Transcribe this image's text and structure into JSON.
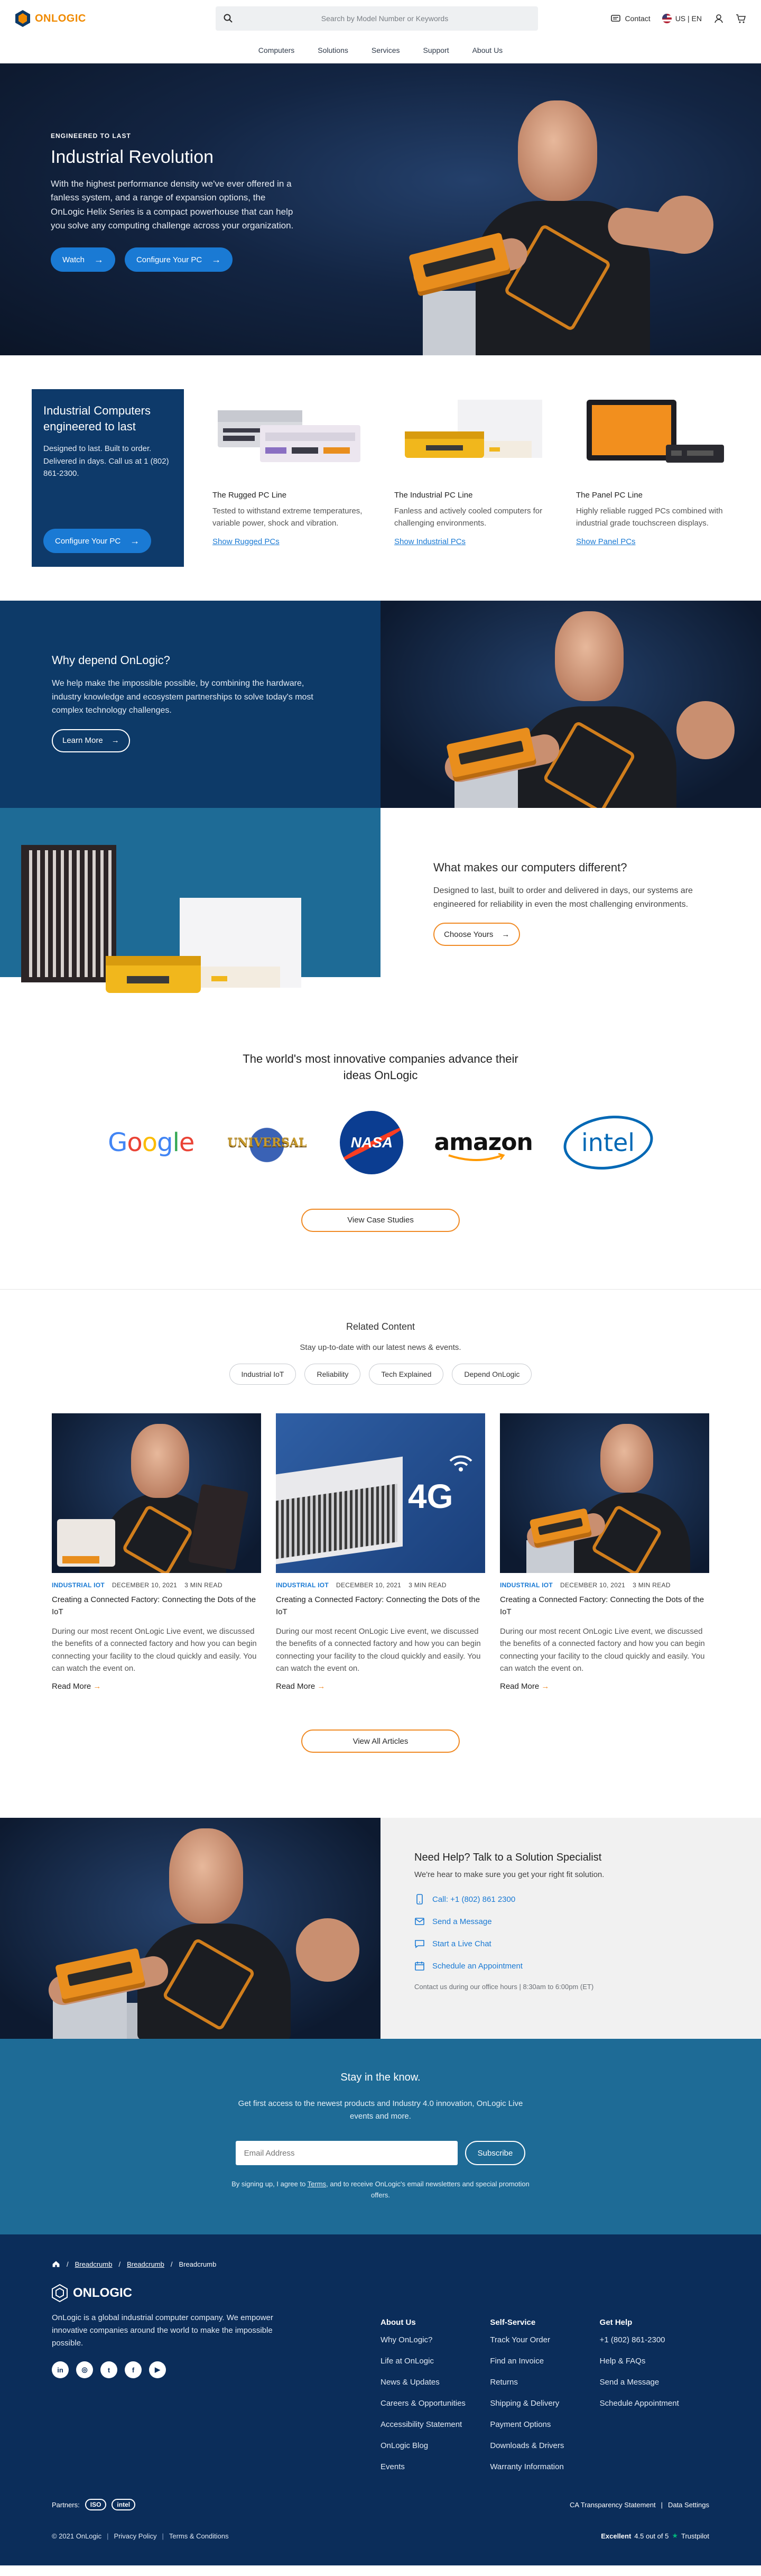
{
  "header": {
    "brand": "ONLOGIC",
    "search_placeholder": "Search by Model Number or Keywords",
    "contact": "Contact",
    "locale": "US | EN",
    "nav": [
      "Computers",
      "Solutions",
      "Services",
      "Support",
      "About Us"
    ]
  },
  "hero": {
    "eyebrow": "ENGINEERED TO LAST",
    "title": "Industrial Revolution",
    "body": "With the highest performance density we've ever offered in a fanless system, and a range of expansion options, the OnLogic Helix Series is a compact powerhouse that can help you solve any computing challenge across your organization.",
    "watch": "Watch",
    "configure": "Configure Your PC"
  },
  "lines": {
    "card_title": "Industrial Computers engineered to last",
    "card_body": "Designed to last. Built to order. Delivered in days. Call us at 1 (802) 861-2300.",
    "card_button": "Configure Your PC",
    "products": [
      {
        "name": "The Rugged PC Line",
        "desc": "Tested to withstand extreme temperatures, variable power, shock and vibration.",
        "link": "Show Rugged PCs"
      },
      {
        "name": "The Industrial PC Line",
        "desc": "Fanless and actively cooled computers for challenging environments.",
        "link": "Show Industrial PCs"
      },
      {
        "name": "The Panel PC Line",
        "desc": "Highly reliable rugged PCs combined with industrial grade touchscreen displays.",
        "link": "Show Panel PCs"
      }
    ]
  },
  "why": {
    "title": "Why depend OnLogic?",
    "body": "We help make the impossible possible, by combining the hardware, industry knowledge and ecosystem partnerships to solve today's most complex technology challenges.",
    "button": "Learn More"
  },
  "diff": {
    "title": "What makes our computers different?",
    "body": "Designed to last, built to order and delivered in days, our systems are engineered for reliability in even the most challenging environments.",
    "button": "Choose Yours"
  },
  "logos": {
    "title": "The world's most innovative companies advance their ideas OnLogic",
    "companies": [
      "Google",
      "UNIVERSAL",
      "NASA",
      "amazon",
      "intel"
    ],
    "button": "View Case Studies"
  },
  "related": {
    "title": "Related Content",
    "sub": "Stay up-to-date with our latest news & events.",
    "chips": [
      "Industrial IoT",
      "Reliability",
      "Tech Explained",
      "Depend OnLogic"
    ],
    "articles": [
      {
        "category": "INDUSTRIAL IOT",
        "date": "DECEMBER 10, 2021",
        "read": "3 MIN READ",
        "title": "Creating a Connected Factory: Connecting the Dots of the IoT",
        "body": "During our most recent OnLogic Live event, we discussed the benefits of a connected factory and how you can begin connecting your facility to the cloud quickly and easily. You can watch the event on.",
        "more": "Read More"
      },
      {
        "category": "INDUSTRIAL IOT",
        "date": "DECEMBER 10, 2021",
        "read": "3 MIN READ",
        "title": "Creating a Connected Factory: Connecting the Dots of the IoT",
        "body": "During our most recent OnLogic Live event, we discussed the benefits of a connected factory and how you can begin connecting your facility to the cloud quickly and easily. You can watch the event on.",
        "more": "Read More"
      },
      {
        "category": "INDUSTRIAL IOT",
        "date": "DECEMBER 10, 2021",
        "read": "3 MIN READ",
        "title": "Creating a Connected Factory: Connecting the Dots of the IoT",
        "body": "During our most recent OnLogic Live event, we discussed the benefits of a connected factory and how you can begin connecting your facility to the cloud quickly and easily. You can watch the event on.",
        "more": "Read More"
      }
    ],
    "article2_badge": "4G",
    "button": "View All Articles"
  },
  "specialist": {
    "title": "Need Help? Talk to a Solution Specialist",
    "sub": "We're hear to make sure you get your right fit solution.",
    "call": "Call: +1 (802) 861 2300",
    "message": "Send a Message",
    "chat": "Start a Live Chat",
    "appointment": "Schedule an Appointment",
    "hours": "Contact us during our office hours | 8:30am to 6:00pm (ET)"
  },
  "newsletter": {
    "title": "Stay in the know.",
    "sub": "Get first access to the newest products and Industry 4.0 innovation, OnLogic Live events and more.",
    "placeholder": "Email Address",
    "button": "Subscribe",
    "legal_a": "By signing up, I agree to",
    "legal_terms": "Terms",
    "legal_b": ", and to receive OnLogic's email newsletters and special promotion offers."
  },
  "footer": {
    "crumbs": [
      "Breadcrumb",
      "Breadcrumb",
      "Breadcrumb"
    ],
    "brand": "ONLOGIC",
    "about": "OnLogic is a global industrial computer company. We empower innovative companies around the world to make the impossible possible.",
    "columns": [
      {
        "title": "About Us",
        "links": [
          "Why OnLogic?",
          "Life at OnLogic",
          "News & Updates",
          "Careers & Opportunities",
          "Accessibility Statement",
          "OnLogic Blog",
          "Events"
        ]
      },
      {
        "title": "Self-Service",
        "links": [
          "Track Your Order",
          "Find an Invoice",
          "Returns",
          "Shipping & Delivery",
          "Payment Options",
          "Downloads & Drivers",
          "Warranty Information"
        ]
      },
      {
        "title": "Get Help",
        "links": [
          "+1 (802) 861-2300",
          "Help & FAQs",
          "Send a Message",
          "Schedule Appointment"
        ]
      }
    ],
    "partners_label": "Partners:",
    "partners": [
      "ISO",
      "intel"
    ],
    "ca_transparency": "CA Transparency Statement",
    "data_settings": "Data Settings",
    "copyright": "© 2021 OnLogic",
    "privacy": "Privacy Policy",
    "terms": "Terms & Conditions",
    "trust_label": "Excellent",
    "trust_score": "4.5 out of 5",
    "trustpilot": "Trustpilot"
  },
  "colors": {
    "brand_orange": "#f08a00",
    "accent_blue": "#1a7ad4",
    "navy": "#0d3a68",
    "teal": "#1e6b96",
    "footer_navy": "#0b2d5a"
  }
}
